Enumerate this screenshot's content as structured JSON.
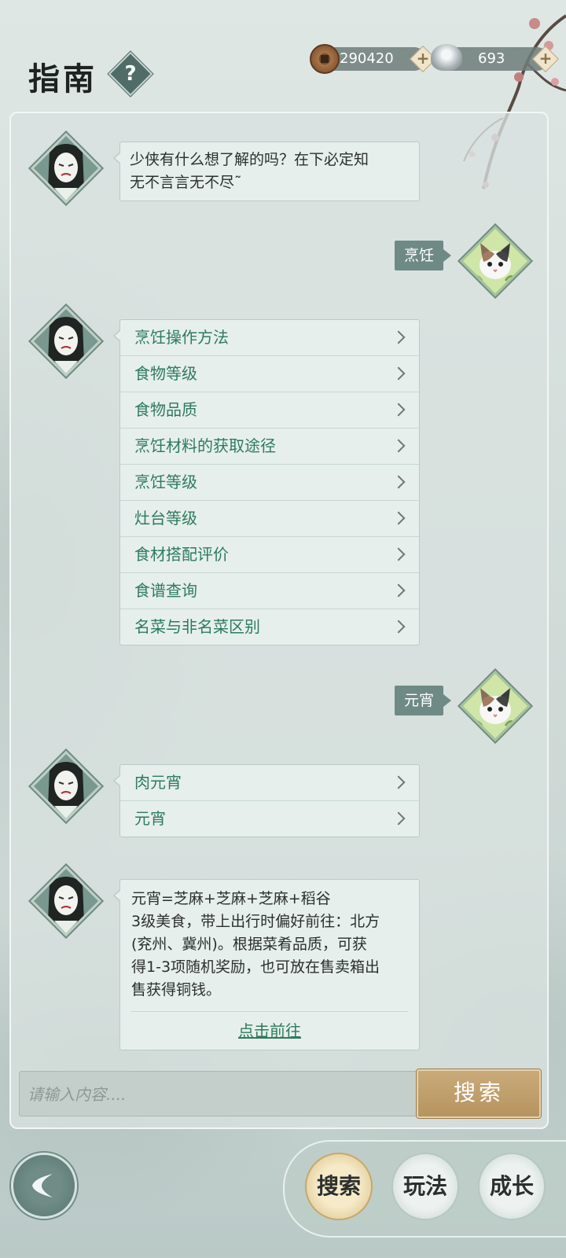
{
  "header": {
    "title": "指南",
    "help_label": "?"
  },
  "currency": {
    "coins": "290420",
    "silver": "693",
    "plus": "+"
  },
  "chat": {
    "npc_greeting": [
      "少侠有什么想了解的吗？在下必定知",
      "无不言言无不尽˜"
    ],
    "user_query_1": "烹饪",
    "topics": [
      "烹饪操作方法",
      "食物等级",
      "食物品质",
      "烹饪材料的获取途径",
      "烹饪等级",
      "灶台等级",
      "食材搭配评价",
      "食谱查询",
      "名菜与非名菜区别"
    ],
    "user_query_2": "元宵",
    "results": [
      "肉元宵",
      "元宵"
    ],
    "info_lines": [
      "元宵=芝麻+芝麻+芝麻+稻谷",
      "3级美食，带上出行时偏好前往：北方",
      "(兖州、冀州)。根据菜肴品质，可获",
      "得1-3项随机奖励，也可放在售卖箱出",
      "售获得铜钱。"
    ],
    "goto_label": "点击前往"
  },
  "search": {
    "placeholder": "请输入内容....",
    "button_label": "搜索"
  },
  "bottom_nav": {
    "search": "搜索",
    "gameplay": "玩法",
    "growth": "成长"
  },
  "icons": {
    "coin": "copper-coin-icon",
    "silver": "silver-ingot-icon",
    "npc": "npc-avatar",
    "cat": "cat-avatar",
    "back": "back-arrow-icon"
  },
  "colors": {
    "accent_green": "#2e7a5e",
    "tag_bg": "#6f8a85",
    "search_button": "#b69460"
  }
}
